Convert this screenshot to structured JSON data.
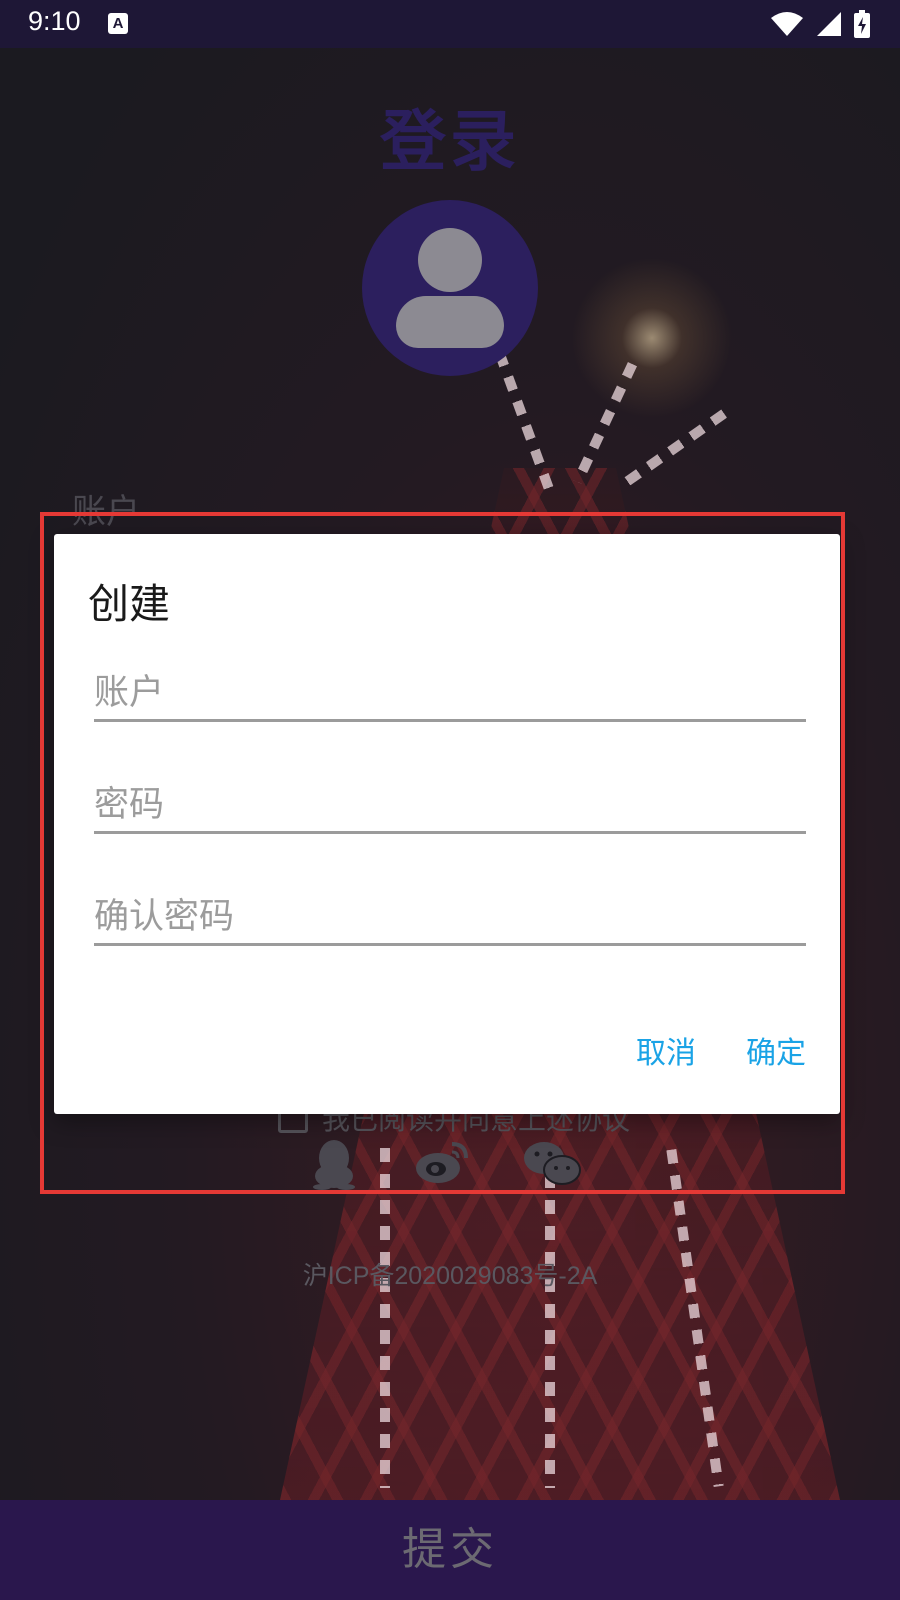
{
  "status_bar": {
    "time": "9:10",
    "notification_glyph": "A",
    "icons": [
      "wifi-icon",
      "signal-icon",
      "battery-charging-icon"
    ]
  },
  "background": {
    "title": "登录",
    "account_label": "账户",
    "agreement_text": "我已阅读并同意上述协议",
    "socials": [
      "qq-icon",
      "weibo-icon",
      "wechat-icon"
    ],
    "icp": "沪ICP备2020029083号-2A",
    "submit_label": "提交"
  },
  "dialog": {
    "title": "创建",
    "fields": {
      "account_placeholder": "账户",
      "password_placeholder": "密码",
      "confirm_placeholder": "确认密码"
    },
    "cancel_label": "取消",
    "confirm_label": "确定"
  },
  "colors": {
    "status_bar": "#1e1736",
    "accent_purple": "#2a174d",
    "dialog_button": "#1aa3e6",
    "highlight": "#e53935"
  }
}
